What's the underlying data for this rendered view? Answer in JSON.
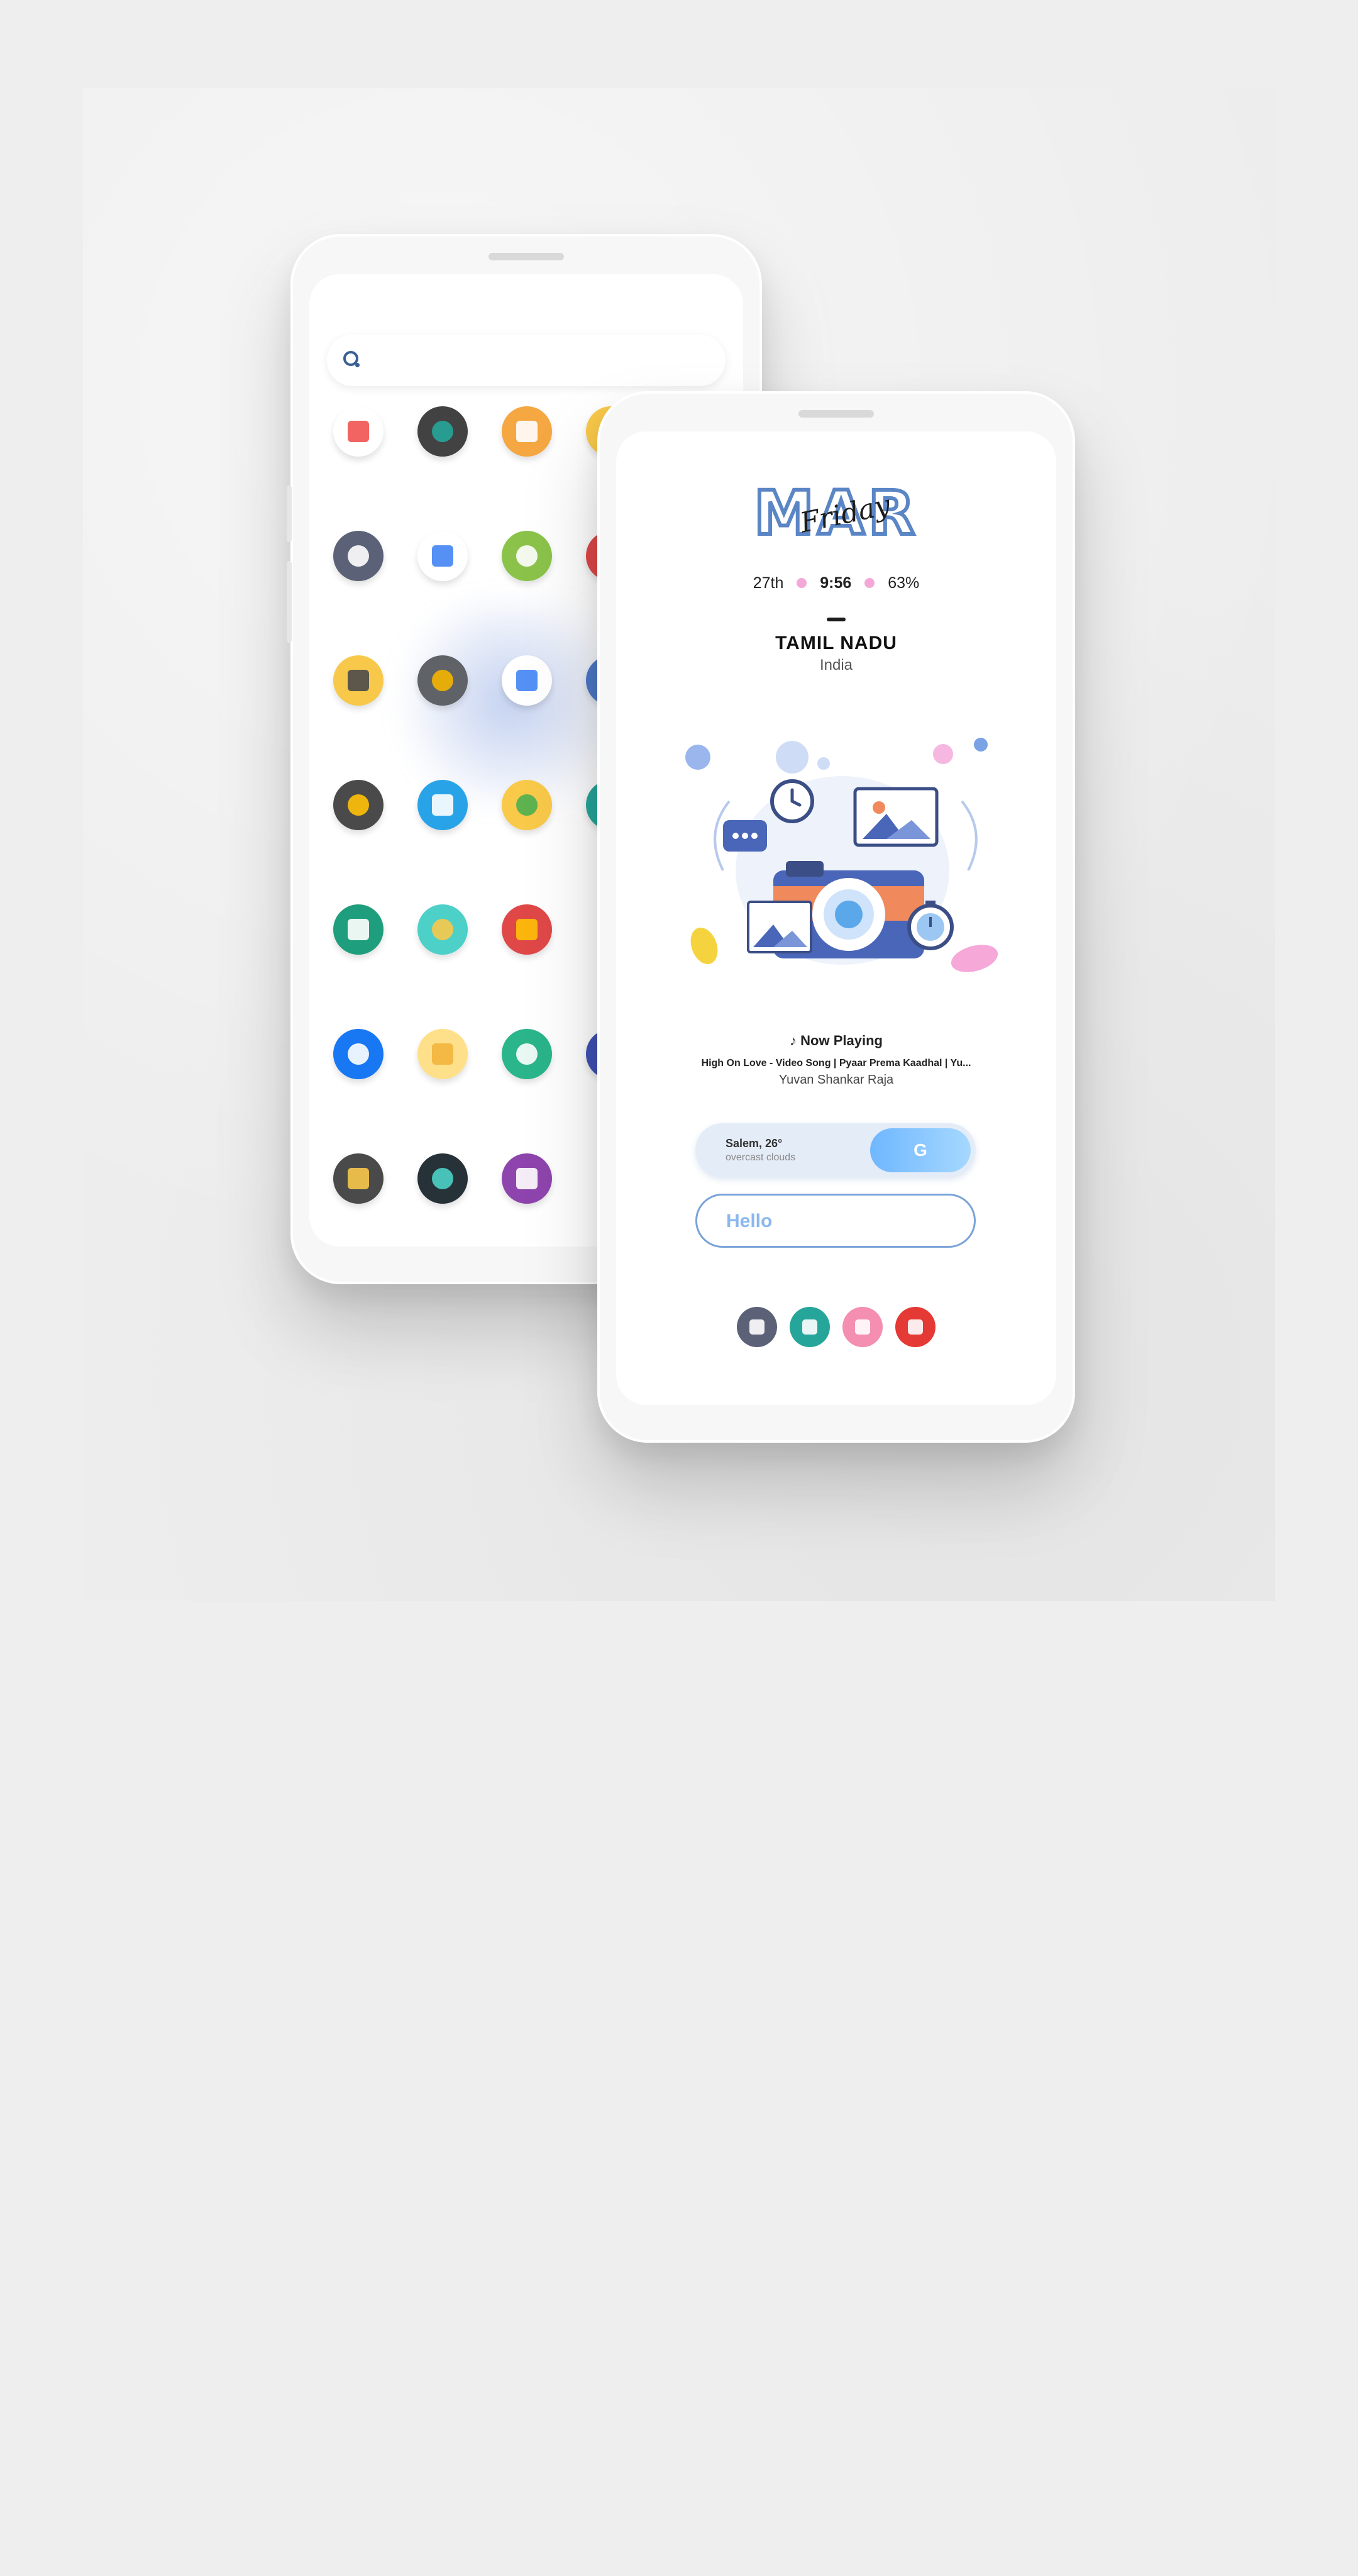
{
  "back_phone": {
    "search": {
      "placeholder": ""
    },
    "app_icons": [
      {
        "name": "downloads-icon",
        "color": "#ffffff",
        "accent": "#ef5350"
      },
      {
        "name": "film-icon",
        "color": "#424242",
        "accent": "#26a69a"
      },
      {
        "name": "amazon-icon",
        "color": "#f5a742",
        "accent": "#ffffff"
      },
      {
        "name": "gallery-icon",
        "color": "#f9c94a",
        "accent": "#ffffff"
      },
      {
        "name": "bat-mask-icon",
        "color": "#5b6277",
        "accent": "#ffffff"
      },
      {
        "name": "google-assistant-icon",
        "color": "#ffffff",
        "accent": "#4285f4"
      },
      {
        "name": "feedly-icon",
        "color": "#8bc34a",
        "accent": "#ffffff"
      },
      {
        "name": "app-icon-red",
        "color": "#e04848",
        "accent": "#ffffff"
      },
      {
        "name": "camera-icon",
        "color": "#f7c84a",
        "accent": "#4a4a4a"
      },
      {
        "name": "photos-camera-icon",
        "color": "#5f6368",
        "accent": "#f4b400"
      },
      {
        "name": "chrome-icon",
        "color": "#ffffff",
        "accent": "#4285f4"
      },
      {
        "name": "app-icon-blue",
        "color": "#4d78c8",
        "accent": "#ffffff"
      },
      {
        "name": "color-palette-icon",
        "color": "#4a4a4a",
        "accent": "#ffc107"
      },
      {
        "name": "contacts-icon",
        "color": "#29a3e8",
        "accent": "#ffffff"
      },
      {
        "name": "calendar-clock-icon",
        "color": "#f9c94a",
        "accent": "#4caf50"
      },
      {
        "name": "app-icon-teal",
        "color": "#26a69a",
        "accent": "#ffffff"
      },
      {
        "name": "calculator-icon",
        "color": "#1e9e7c",
        "accent": "#ffffff"
      },
      {
        "name": "data-usage-icon",
        "color": "#4dd0c8",
        "accent": "#f7c84a"
      },
      {
        "name": "lock-icon",
        "color": "#e04848",
        "accent": "#ffc107"
      },
      {
        "name": "facebook-icon",
        "color": "#1877f2",
        "accent": "#ffffff"
      },
      {
        "name": "file-manager-icon",
        "color": "#ffe08a",
        "accent": "#f2b53c"
      },
      {
        "name": "download-arrow-icon",
        "color": "#2ab58a",
        "accent": "#ffffff"
      },
      {
        "name": "app-icon-indigo",
        "color": "#3f51b5",
        "accent": "#ffffff"
      },
      {
        "name": "radio-icon",
        "color": "#4a4a4a",
        "accent": "#f7c84a"
      },
      {
        "name": "bunny-icon",
        "color": "#263238",
        "accent": "#4dd0c8"
      },
      {
        "name": "hexagon-icon",
        "color": "#8e44ad",
        "accent": "#ffffff"
      }
    ]
  },
  "front_phone": {
    "month": "MAR",
    "weekday": "Friday",
    "date": "27th",
    "time": "9:56",
    "battery": "63%",
    "location": "TAMIL NADU",
    "country": "India",
    "now_playing_label": "♪ Now Playing",
    "song_title": "High On Love - Video Song | Pyaar Prema Kaadhal | Yu...",
    "artist": "Yuvan Shankar Raja",
    "weather": {
      "line1": "Salem, 26°",
      "line2": "overcast clouds",
      "search_button": "G"
    },
    "hello_text": "Hello",
    "dock_icons": [
      {
        "name": "car-shortcut-icon",
        "color": "#5b6277"
      },
      {
        "name": "whatsapp-plus-icon",
        "color": "#26a69a"
      },
      {
        "name": "camera-app-icon",
        "color": "#f48fb1"
      },
      {
        "name": "youtube-play-icon",
        "color": "#e53935"
      }
    ]
  },
  "colors": {
    "accent_blue": "#5b86c6",
    "pink_dot": "#f4a8d8",
    "background": "#eeeeee"
  }
}
